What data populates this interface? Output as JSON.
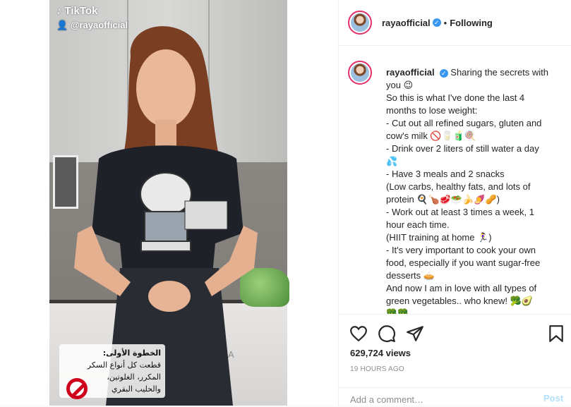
{
  "video": {
    "tiktok_logo": "TikTok",
    "tiktok_user": "@rayaofficial",
    "arabic_caption": {
      "title": "الخطوة الأولى:",
      "lines": [
        "قطعت كل أنواع السكر",
        "المكرر، الغلوتين،",
        "والحليب البقري"
      ]
    }
  },
  "header": {
    "username": "rayaofficial",
    "separator": "•",
    "follow_status": "Following"
  },
  "caption": {
    "username": "rayaofficial",
    "lines": [
      "Sharing the secrets with",
      "you 😉",
      "So this is what I've done the last 4",
      "months to lose weight:",
      "- Cut out all refined sugars, gluten and",
      "cow's milk 🚫🥛🧃🍭",
      "- Drink over 2 liters of still water a day",
      "💦",
      "- Have 3 meals and 2 snacks",
      "(Low carbs, healthy fats, and lots of",
      "protein 🍳🍗🥩🥗🍌🍠🥜)",
      "- Work out at least 3 times a week, 1",
      "hour each time.",
      "(HIIT training at home 🏃‍♀️)",
      "- It's very important to cook your own",
      "food, especially if you want sugar-free",
      "desserts 🥧",
      "And now I am in love with all types of",
      "green vegetables.. who knew! 🥦🥑",
      "🥦🥦"
    ]
  },
  "stats": {
    "views": "629,724 views",
    "timestamp": "19 HOURS AGO"
  },
  "comment": {
    "placeholder": "Add a comment…",
    "post_label": "Post"
  },
  "scroll_fragment": "A"
}
